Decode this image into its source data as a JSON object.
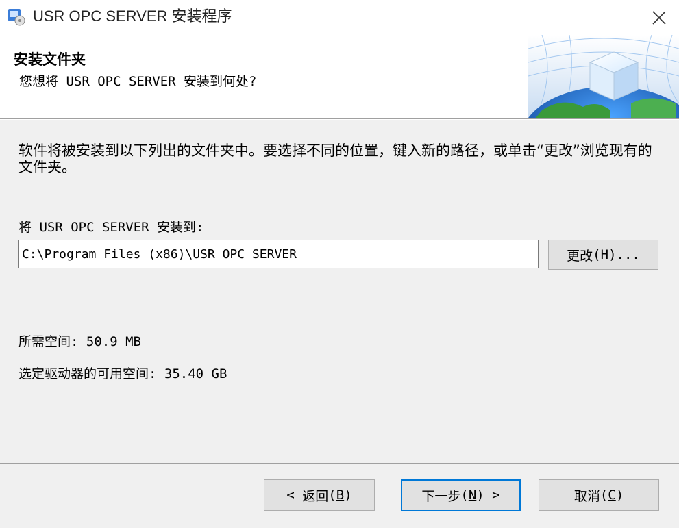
{
  "window": {
    "title": "USR OPC SERVER 安装程序",
    "close_symbol": "✕",
    "icons": {
      "app": "installer-app-icon",
      "close": "close-icon"
    }
  },
  "header": {
    "title": "安装文件夹",
    "subtitle": "您想将 USR OPC SERVER 安装到何处?",
    "banner_icon": "globe-cube-banner"
  },
  "main": {
    "description": "软件将被安装到以下列出的文件夹中。要选择不同的位置，键入新的路径，或单击“更改”浏览现有的文件夹。",
    "install_to_label": "将 USR OPC SERVER 安装到:",
    "install_path": "C:\\Program Files (x86)\\USR OPC SERVER",
    "change_button": {
      "label": "更改",
      "hotkey": "H",
      "suffix": "..."
    },
    "space_required": "所需空间: 50.9 MB",
    "space_available": "选定驱动器的可用空间: 35.40 GB"
  },
  "footer": {
    "back_button": {
      "prefix": "< ",
      "label": "返回",
      "hotkey": "B"
    },
    "next_button": {
      "label": "下一步",
      "hotkey": "N",
      "suffix": " >"
    },
    "cancel_button": {
      "label": "取消",
      "hotkey": "C"
    }
  },
  "colors": {
    "window_bg": "#f0f0f0",
    "header_bg": "#ffffff",
    "default_button_border": "#0078d7",
    "button_bg": "#e1e1e1"
  }
}
